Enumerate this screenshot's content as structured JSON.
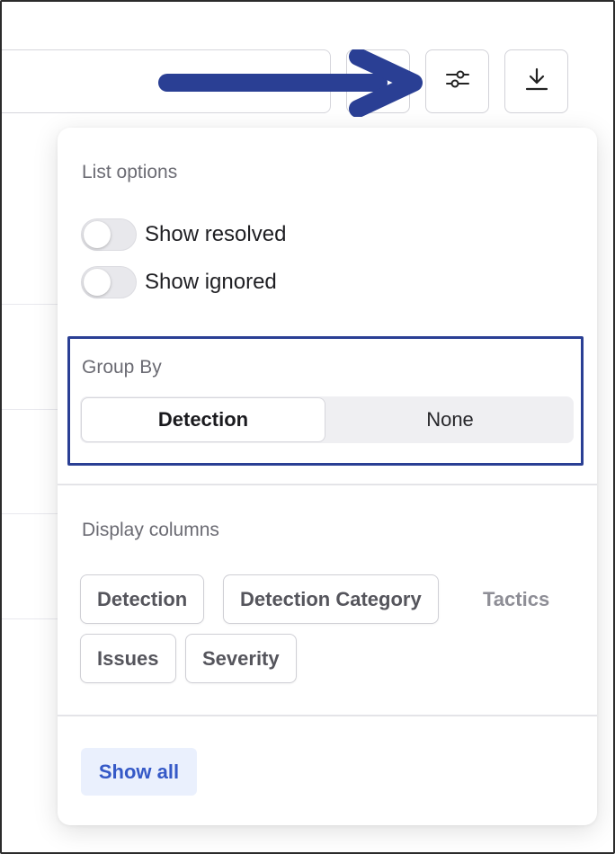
{
  "list_options": {
    "title": "List options",
    "toggles": [
      {
        "label": "Show resolved",
        "on": false
      },
      {
        "label": "Show ignored",
        "on": false
      }
    ]
  },
  "group_by": {
    "title": "Group By",
    "options": [
      "Detection",
      "None"
    ],
    "selected": "Detection"
  },
  "display_columns": {
    "title": "Display columns",
    "columns": [
      {
        "label": "Detection",
        "selected": true
      },
      {
        "label": "Detection Category",
        "selected": true
      },
      {
        "label": "Tactics",
        "selected": false
      },
      {
        "label": "Issues",
        "selected": true
      },
      {
        "label": "Severity",
        "selected": true
      }
    ]
  },
  "footer": {
    "show_all_label": "Show all"
  },
  "colors": {
    "accent": "#3559c7",
    "highlight_box": "#2a3f94",
    "arrow": "#2a3f94"
  },
  "icons": [
    "sliders-icon",
    "download-icon",
    "arrow-right-icon"
  ]
}
